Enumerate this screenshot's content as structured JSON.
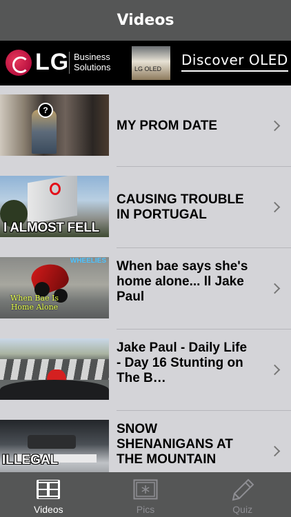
{
  "navbar": {
    "title": "Videos"
  },
  "ad": {
    "brand": "LG",
    "tagline_line1": "Business",
    "tagline_line2": "Solutions",
    "tv_label": "LG OLED",
    "cta": "Discover OLED"
  },
  "videos": [
    {
      "title": "MY PROM DATE",
      "thumb_overlay": "?"
    },
    {
      "title": "CAUSING TROUBLE IN PORTUGAL",
      "thumb_overlay": "I ALMOST FELL"
    },
    {
      "title": "When bae says she's home alone... ll Jake Paul",
      "thumb_overlay": "WHEELIES",
      "thumb_overlay2": "When Bae Is Home Alone"
    },
    {
      "title": "Jake Paul - Daily Life - Day 16 Stunting on The B…",
      "thumb_overlay": ""
    },
    {
      "title": "SNOW SHENANIGANS AT THE MOUNTAIN",
      "thumb_overlay": "ILLEGAL"
    }
  ],
  "tabs": [
    {
      "label": "Videos",
      "icon": "film-strip-icon",
      "active": true
    },
    {
      "label": "Pics",
      "icon": "snowflake-photo-icon",
      "active": false
    },
    {
      "label": "Quiz",
      "icon": "pencil-icon",
      "active": false
    }
  ],
  "colors": {
    "bar": "#555656",
    "list_bg": "#d4d4d8",
    "active_tab": "#ffffff",
    "inactive_tab": "#8e8e93"
  }
}
